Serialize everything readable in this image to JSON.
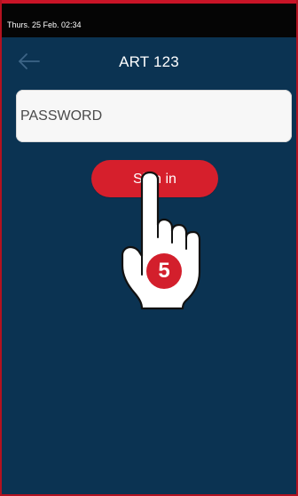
{
  "status_bar": {
    "datetime": "Thurs. 25 Feb. 02:34"
  },
  "header": {
    "title": "ART 123",
    "back_icon": "back-arrow-icon"
  },
  "login": {
    "password_placeholder": "PASSWORD",
    "password_value": "",
    "signin_label": "Sign in"
  },
  "hint": {
    "icon": "pointing-hand-icon",
    "step": "5"
  },
  "colors": {
    "background": "#0b3352",
    "accent": "#d61f2c",
    "field": "#f7f7f7",
    "status_bar": "#050505"
  }
}
